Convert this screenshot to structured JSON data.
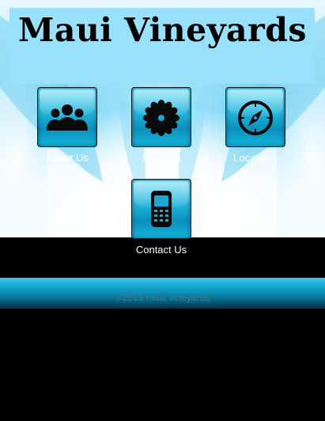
{
  "header": {
    "title": "Maui Vineyards"
  },
  "nav": {
    "items": [
      {
        "label": "About Us",
        "icon": "group-icon"
      },
      {
        "label": "Services",
        "icon": "flower-icon"
      },
      {
        "label": "Locations",
        "icon": "compass-icon"
      },
      {
        "label": "Contact Us",
        "icon": "mobile-phone-icon"
      }
    ]
  },
  "footer": {
    "copyright": "©2019 maui vineyards"
  },
  "colors": {
    "header_bg": "#99e1fa",
    "tile_blue": "#1fb2da",
    "page_bg": "#000000",
    "footer_text": "#3f7a8c"
  }
}
